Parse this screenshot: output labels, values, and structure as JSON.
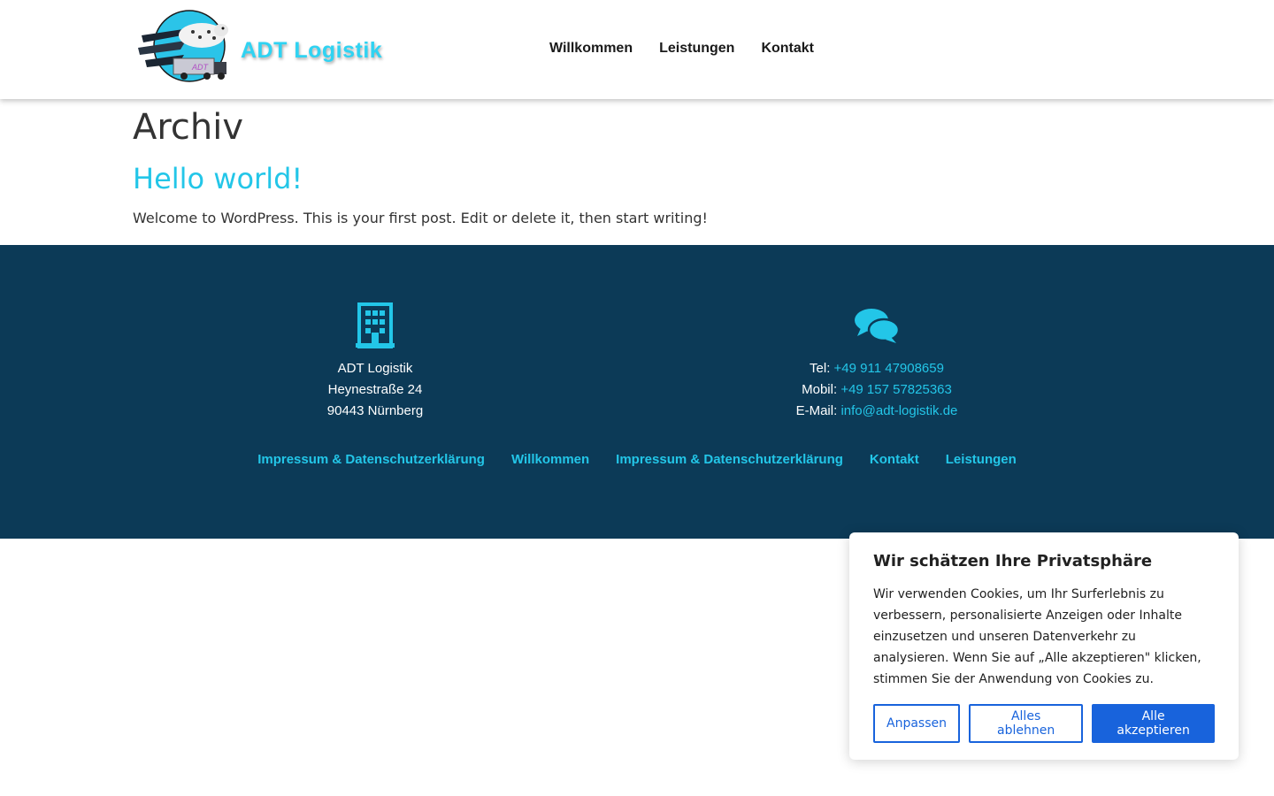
{
  "header": {
    "logo_text": "ADT Logistik",
    "logo_truck_label": "ADT",
    "nav": [
      {
        "label": "Willkommen"
      },
      {
        "label": "Leistungen"
      },
      {
        "label": "Kontakt"
      }
    ]
  },
  "main": {
    "archive_title": "Archiv",
    "post": {
      "title": "Hello world!",
      "excerpt": "Welcome to WordPress. This is your first post. Edit or delete it, then start writing!"
    }
  },
  "footer": {
    "address": {
      "icon": "building-icon",
      "company": "ADT Logistik",
      "street": "Heynestraße 24",
      "city": "90443 Nürnberg"
    },
    "contact": {
      "icon": "chat-bubbles-icon",
      "tel_label": "Tel:",
      "tel_value": "+49 911 47908659",
      "mobile_label": "Mobil:",
      "mobile_value": "+49 157 57825363",
      "email_label": "E-Mail:",
      "email_value": "info@adt-logistik.de"
    },
    "nav": [
      {
        "label": "Impressum & Datenschutzerklärung"
      },
      {
        "label": "Willkommen"
      },
      {
        "label": "Impressum & Datenschutzerklärung"
      },
      {
        "label": "Kontakt"
      },
      {
        "label": "Leistungen"
      }
    ]
  },
  "cookie_banner": {
    "title": "Wir schätzen Ihre Privatsphäre",
    "text": "Wir verwenden Cookies, um Ihr Surferlebnis zu verbessern, personalisierte Anzeigen oder Inhalte einzusetzen und unseren Datenverkehr zu analysieren. Wenn Sie auf „Alle akzeptieren\" klicken, stimmen Sie der Anwendung von Cookies zu.",
    "customize_label": "Anpassen",
    "reject_label": "Alles ablehnen",
    "accept_label": "Alle akzeptieren"
  },
  "colors": {
    "accent": "#23c6e8",
    "footer_bg": "#0c3a57",
    "cookie_button": "#1863dc"
  }
}
